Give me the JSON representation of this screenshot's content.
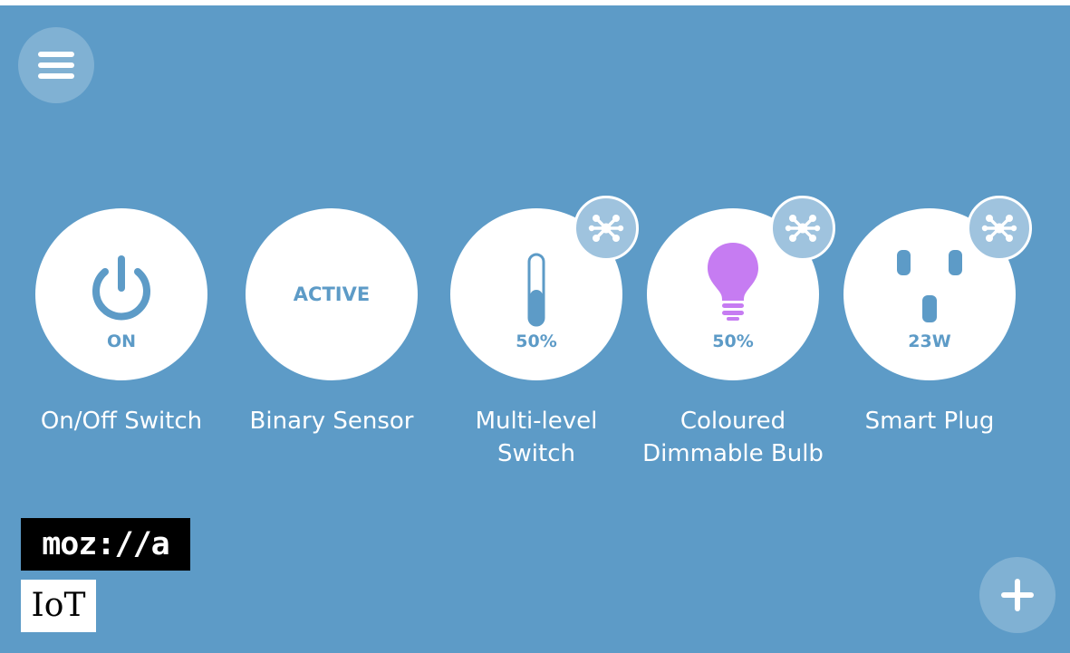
{
  "colors": {
    "background": "#5d9bc7",
    "card": "#ffffff",
    "accent_text": "#5d9bc7",
    "bulb": "#c67cf2",
    "detail_button": "#9fc3de"
  },
  "header": {
    "menu_icon": "hamburger-menu-icon"
  },
  "things": [
    {
      "name": "On/Off Switch",
      "status": "ON",
      "icon": "power-icon",
      "has_detail": false
    },
    {
      "name": "Binary Sensor",
      "status": "ACTIVE",
      "icon": "",
      "has_detail": false
    },
    {
      "name": "Multi-level\nSwitch",
      "status": "50%",
      "level": 0.5,
      "icon": "slider-icon",
      "has_detail": true,
      "detail_icon": "splat-icon"
    },
    {
      "name": "Coloured\nDimmable Bulb",
      "status": "50%",
      "icon": "lightbulb-icon",
      "has_detail": true,
      "detail_icon": "splat-icon"
    },
    {
      "name": "Smart Plug",
      "status": "23W",
      "icon": "outlet-icon",
      "has_detail": true,
      "detail_icon": "splat-icon"
    }
  ],
  "branding": {
    "logo_text": "moz://a",
    "product_text": "IoT"
  },
  "footer": {
    "add_icon": "plus-icon"
  }
}
